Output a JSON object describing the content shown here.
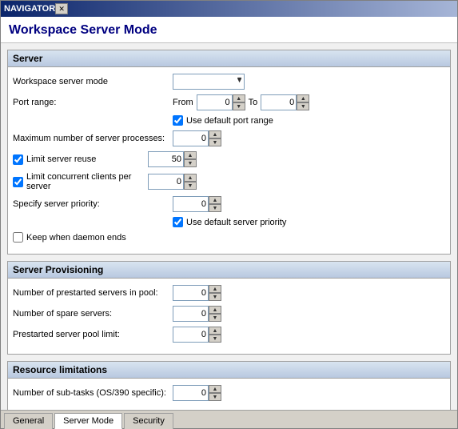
{
  "window": {
    "title": "NAVIGATOR",
    "close_btn": "✕",
    "minimize_btn": "─",
    "maximize_btn": "□"
  },
  "page": {
    "title": "Workspace Server Mode"
  },
  "sections": [
    {
      "id": "server",
      "header": "Server",
      "fields": [
        {
          "id": "workspace-server-mode",
          "label": "Workspace server mode",
          "type": "select",
          "value": ""
        },
        {
          "id": "port-range-from",
          "label": "Port range:",
          "type": "port-range",
          "from_label": "From",
          "from_value": "0",
          "to_label": "To",
          "to_value": "0"
        },
        {
          "id": "use-default-port-range",
          "label": "Use default port range",
          "type": "checkbox-indent",
          "checked": true
        },
        {
          "id": "max-server-processes",
          "label": "Maximum number of server processes:",
          "type": "spinner",
          "value": "0"
        },
        {
          "id": "limit-server-reuse",
          "label": "Limit server reuse",
          "type": "checkbox-spinner",
          "checked": true,
          "value": "50"
        },
        {
          "id": "limit-concurrent-clients",
          "label": "Limit concurrent clients per server",
          "type": "checkbox-spinner",
          "checked": true,
          "value": "0"
        },
        {
          "id": "specify-server-priority",
          "label": "Specify server priority:",
          "type": "spinner",
          "value": "0"
        },
        {
          "id": "use-default-server-priority",
          "label": "Use  default server priority",
          "type": "checkbox-indent",
          "checked": true
        },
        {
          "id": "keep-when-daemon-ends",
          "label": "Keep when daemon ends",
          "type": "checkbox-plain",
          "checked": false
        }
      ]
    },
    {
      "id": "server-provisioning",
      "header": "Server Provisioning",
      "fields": [
        {
          "id": "prestarted-servers-pool",
          "label": "Number of prestarted servers in pool:",
          "type": "spinner",
          "value": "0"
        },
        {
          "id": "spare-servers",
          "label": "Number of spare servers:",
          "type": "spinner",
          "value": "0"
        },
        {
          "id": "prestarted-pool-limit",
          "label": "Prestarted server pool limit:",
          "type": "spinner",
          "value": "0"
        }
      ]
    },
    {
      "id": "resource-limitations",
      "header": "Resource limitations",
      "fields": [
        {
          "id": "sub-tasks",
          "label": "Number of sub-tasks (OS/390 specific):",
          "type": "spinner",
          "value": "0"
        }
      ]
    }
  ],
  "tabs": [
    {
      "id": "general",
      "label": "General",
      "active": false
    },
    {
      "id": "server-mode",
      "label": "Server Mode",
      "active": true
    },
    {
      "id": "security",
      "label": "Security",
      "active": false
    }
  ]
}
